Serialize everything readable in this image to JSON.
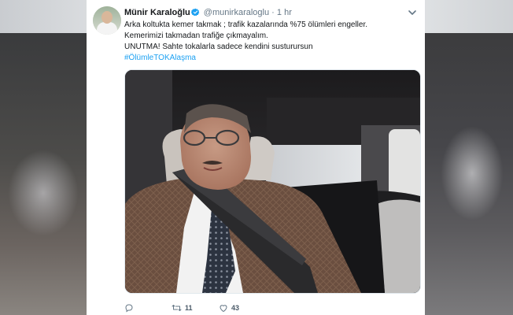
{
  "tweet": {
    "author_name": "Münir Karaloğlu",
    "handle": "@munirkaraloglu",
    "separator": "·",
    "time": "1 hr",
    "lines": [
      "Arka koltukta kemer takmak ; trafik kazalarında %75 ölümleri engeller.",
      "Kemerimizi takmadan trafiğe çıkmayalım.",
      "UNUTMA! Sahte tokalarla sadece kendini susturursun"
    ],
    "hashtag": "#ÖlümleTOKAlaşma",
    "retweet_count": "11",
    "like_count": "43"
  },
  "icons": {
    "verified": "verified-badge-icon",
    "caret": "chevron-down-icon",
    "reply": "reply-icon",
    "retweet": "retweet-icon",
    "like": "heart-icon"
  },
  "colors": {
    "link": "#1da1f2",
    "verified": "#1da1f2",
    "text": "#14171a",
    "muted": "#657786"
  }
}
